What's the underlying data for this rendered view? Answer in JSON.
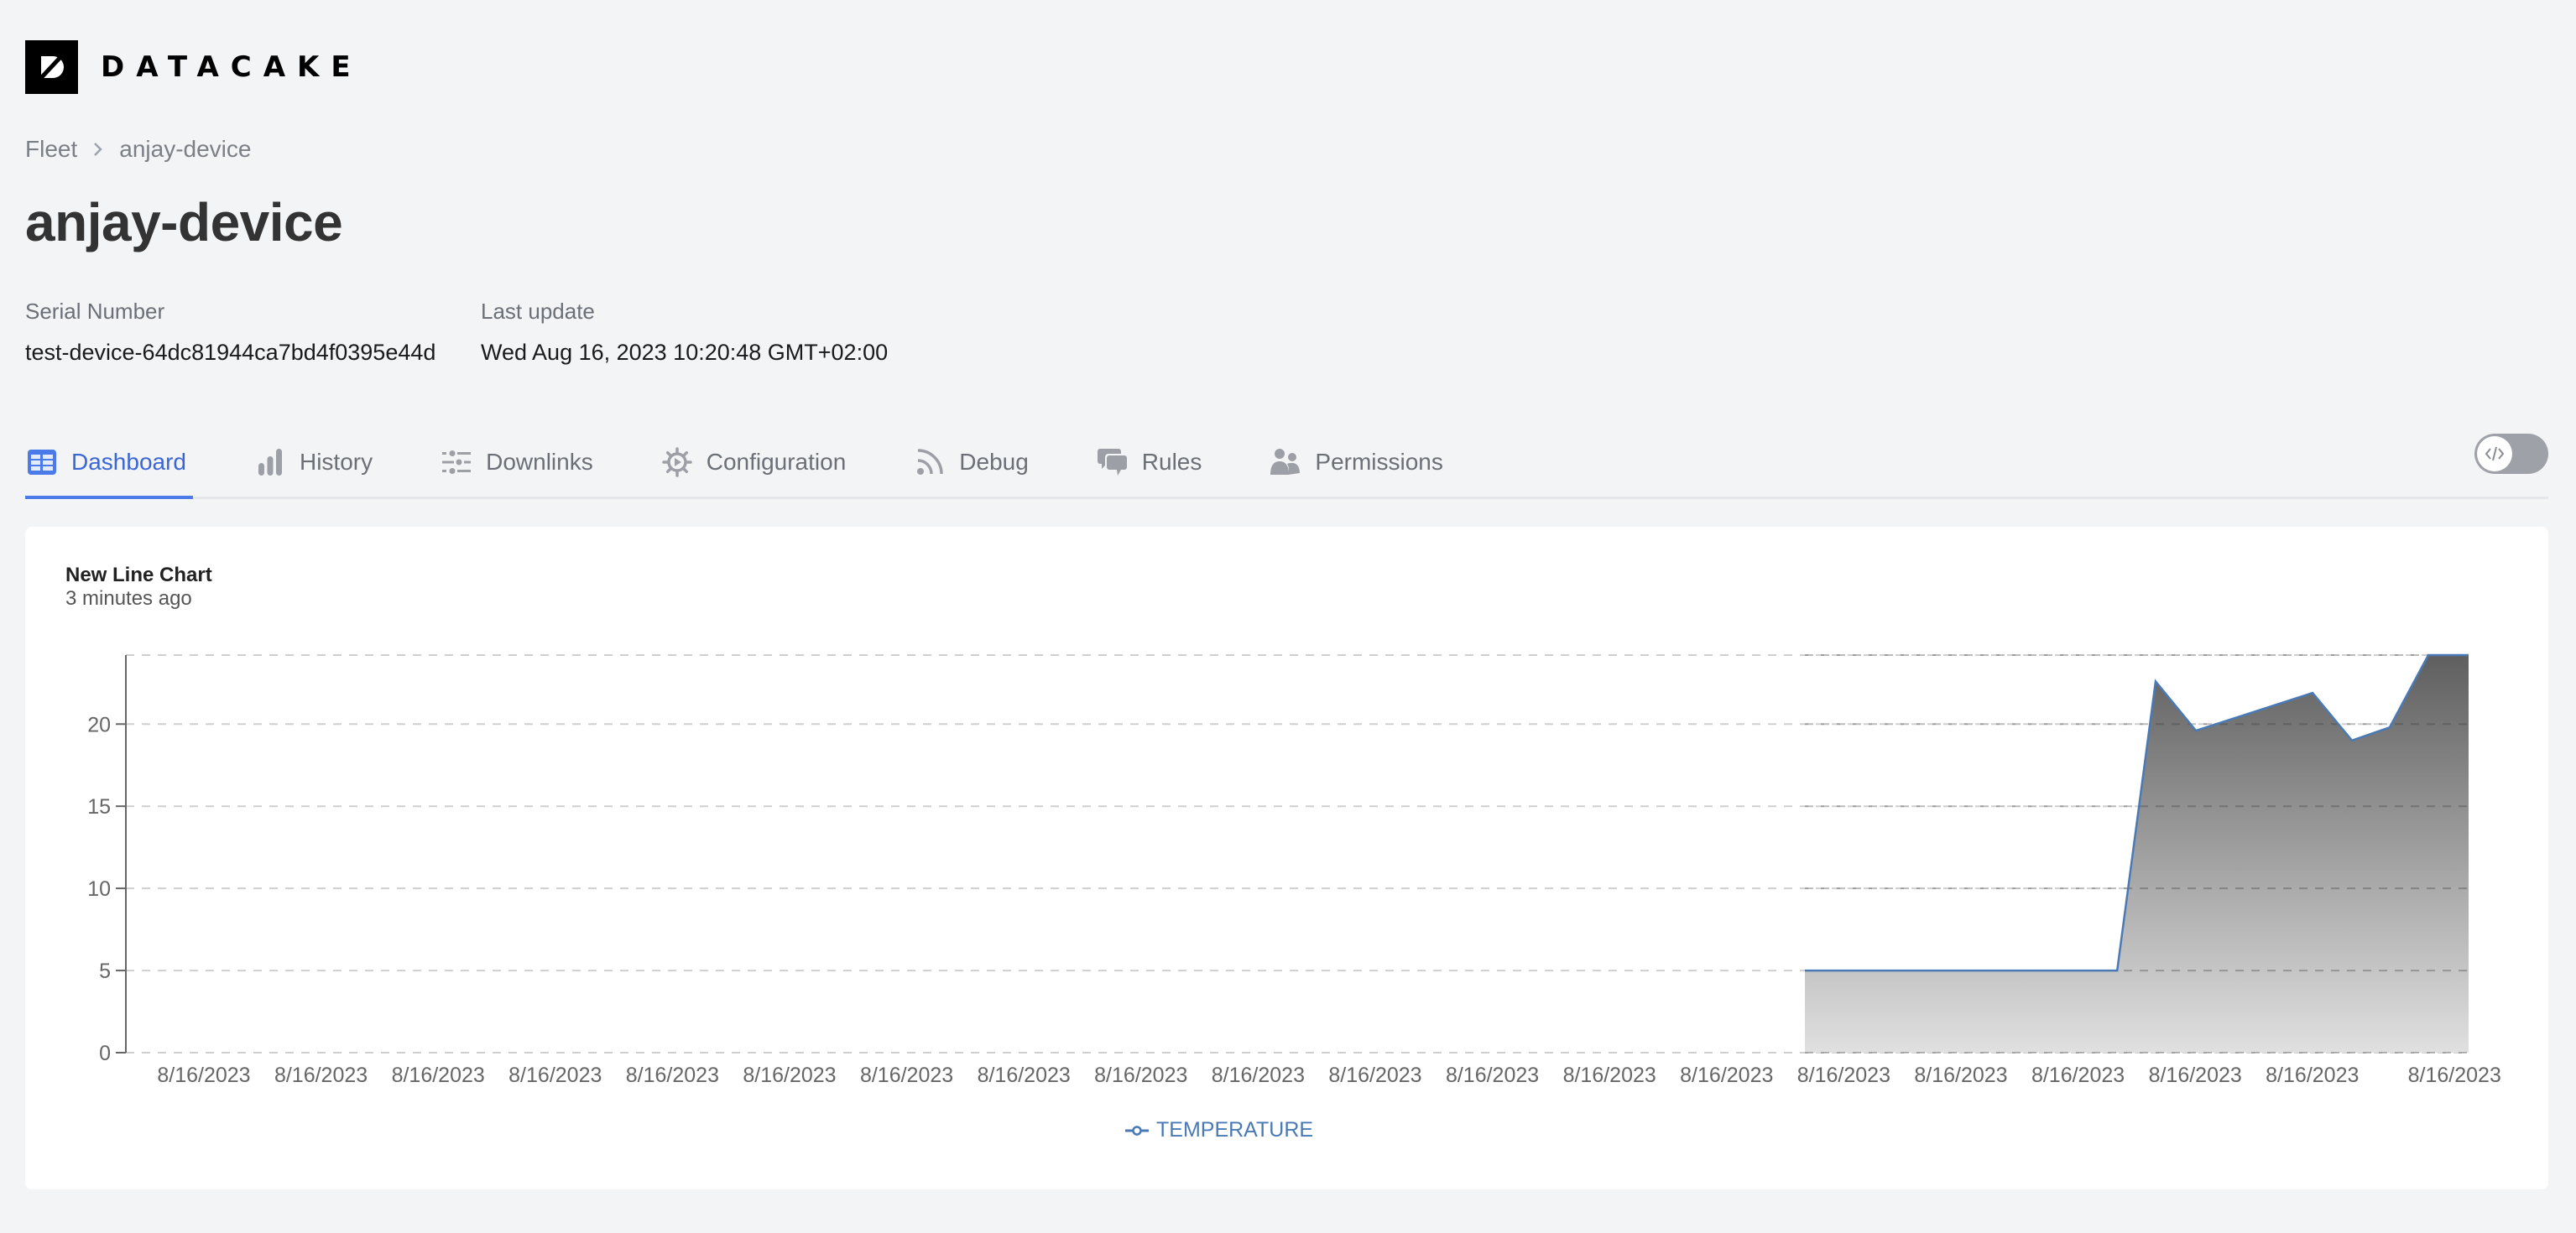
{
  "brand": {
    "name": "DATACAKE",
    "logo_icon": "datacake-logo-icon"
  },
  "breadcrumb": {
    "items": [
      "Fleet",
      "anjay-device"
    ],
    "separator_icon": "chevron-right-icon"
  },
  "device": {
    "title": "anjay-device",
    "serial_label": "Serial Number",
    "serial_value": "test-device-64dc81944ca7bd4f0395e44d",
    "update_label": "Last update",
    "update_value": "Wed Aug 16, 2023 10:20:48 GMT+02:00"
  },
  "tabs": [
    {
      "label": "Dashboard",
      "icon": "table-icon",
      "active": true
    },
    {
      "label": "History",
      "icon": "bar-chart-icon",
      "active": false
    },
    {
      "label": "Downlinks",
      "icon": "sliders-icon",
      "active": false
    },
    {
      "label": "Configuration",
      "icon": "gear-icon",
      "active": false
    },
    {
      "label": "Debug",
      "icon": "rss-icon",
      "active": false
    },
    {
      "label": "Rules",
      "icon": "chat-bubbles-icon",
      "active": false
    },
    {
      "label": "Permissions",
      "icon": "users-icon",
      "active": false
    }
  ],
  "toggle": {
    "icon": "code-icon",
    "on": false
  },
  "colors": {
    "accent": "#3a66d6",
    "tab_underline": "#4a7be8",
    "series_line": "#4a7ab5",
    "area_top": "#5f5f5f",
    "area_bottom": "#e0e0e0"
  },
  "widget": {
    "title": "New Line Chart",
    "subtitle": "3 minutes ago"
  },
  "chart_data": {
    "type": "area",
    "title": "New Line Chart",
    "subtitle": "3 minutes ago",
    "xlabel": "",
    "ylabel": "",
    "x_note": "relative time position across the axis (0 = left edge, 100 = right edge); all tick labels read 8/16/2023",
    "xlim": [
      0,
      100
    ],
    "ylim": [
      0,
      24.2
    ],
    "yticks": [
      0,
      5,
      10,
      15,
      20
    ],
    "xticks": [
      {
        "x": 3.33,
        "label": "8/16/2023"
      },
      {
        "x": 8.33,
        "label": "8/16/2023"
      },
      {
        "x": 13.33,
        "label": "8/16/2023"
      },
      {
        "x": 18.33,
        "label": "8/16/2023"
      },
      {
        "x": 23.33,
        "label": "8/16/2023"
      },
      {
        "x": 28.33,
        "label": "8/16/2023"
      },
      {
        "x": 33.33,
        "label": "8/16/2023"
      },
      {
        "x": 38.33,
        "label": "8/16/2023"
      },
      {
        "x": 43.33,
        "label": "8/16/2023"
      },
      {
        "x": 48.33,
        "label": "8/16/2023"
      },
      {
        "x": 53.33,
        "label": "8/16/2023"
      },
      {
        "x": 58.33,
        "label": "8/16/2023"
      },
      {
        "x": 63.33,
        "label": "8/16/2023"
      },
      {
        "x": 68.33,
        "label": "8/16/2023"
      },
      {
        "x": 73.33,
        "label": "8/16/2023"
      },
      {
        "x": 78.33,
        "label": "8/16/2023"
      },
      {
        "x": 83.33,
        "label": "8/16/2023"
      },
      {
        "x": 88.33,
        "label": "8/16/2023"
      },
      {
        "x": 93.33,
        "label": "8/16/2023"
      },
      {
        "x": 99.4,
        "label": "8/16/2023"
      }
    ],
    "grid": true,
    "legend_position": "bottom-center",
    "series": [
      {
        "name": "TEMPERATURE",
        "x": [
          71.67,
          85.0,
          86.64,
          88.36,
          93.34,
          95.02,
          96.63,
          98.28,
          100
        ],
        "values": [
          5,
          5,
          22.6,
          19.6,
          21.9,
          19.0,
          19.8,
          24.2,
          24.2
        ]
      }
    ]
  }
}
